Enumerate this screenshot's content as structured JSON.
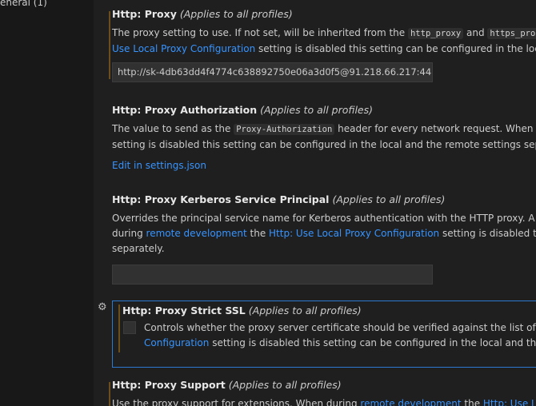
{
  "sidebar": {
    "item_label": "eneral (1)"
  },
  "settings": {
    "proxy": {
      "prefix": "Http: ",
      "name": "Proxy",
      "scope": "(Applies to all profiles)",
      "desc1_a": "The proxy setting to use. If not set, will be inherited from the ",
      "code1": "http_proxy",
      "desc1_b": " and ",
      "code2": "https_proxy",
      "desc1_c": " e",
      "link1": "Use Local Proxy Configuration",
      "desc2": " setting is disabled this setting can be configured in the local and",
      "value": "http://sk-4db63dd4f4774c638892750e06a3d0f5@91.218.66.217:443"
    },
    "proxy_authorization": {
      "prefix": "Http: ",
      "name": "Proxy Authorization",
      "scope": "(Applies to all profiles)",
      "desc1_a": "The value to send as the ",
      "code": "Proxy-Authorization",
      "desc1_b": " header for every network request. When durin",
      "desc2": "setting is disabled this setting can be configured in the local and the remote settings separatel",
      "edit_link": "Edit in settings.json"
    },
    "proxy_kerberos": {
      "prefix": "Http: ",
      "name": "Proxy Kerberos Service Principal",
      "scope": "(Applies to all profiles)",
      "desc1": "Overrides the principal service name for Kerberos authentication with the HTTP proxy. A defaul",
      "desc2_a": "during ",
      "link1": "remote development",
      "desc2_b": " the ",
      "link2": "Http: Use Local Proxy Configuration",
      "desc2_c": " setting is disabled this set",
      "desc3": "separately.",
      "value": ""
    },
    "proxy_strict_ssl": {
      "prefix": "Http: ",
      "name": "Proxy Strict SSL",
      "scope": "(Applies to all profiles)",
      "desc1": "Controls whether the proxy server certificate should be verified against the list of supplied",
      "link1": "Configuration",
      "desc2": " setting is disabled this setting can be configured in the local and the remot",
      "checked": false
    },
    "proxy_support": {
      "prefix": "Http: ",
      "name": "Proxy Support",
      "scope": "(Applies to all profiles)",
      "desc1_a": "Use the proxy support for extensions. When during ",
      "link1": "remote development",
      "desc1_b": " the ",
      "link2": "Http: Use Local P"
    }
  },
  "icons": {
    "gear": "gear-icon"
  },
  "colors": {
    "link": "#3794ff",
    "focus_border": "#2b79d0",
    "modified_marker": "#6c4d1c"
  }
}
